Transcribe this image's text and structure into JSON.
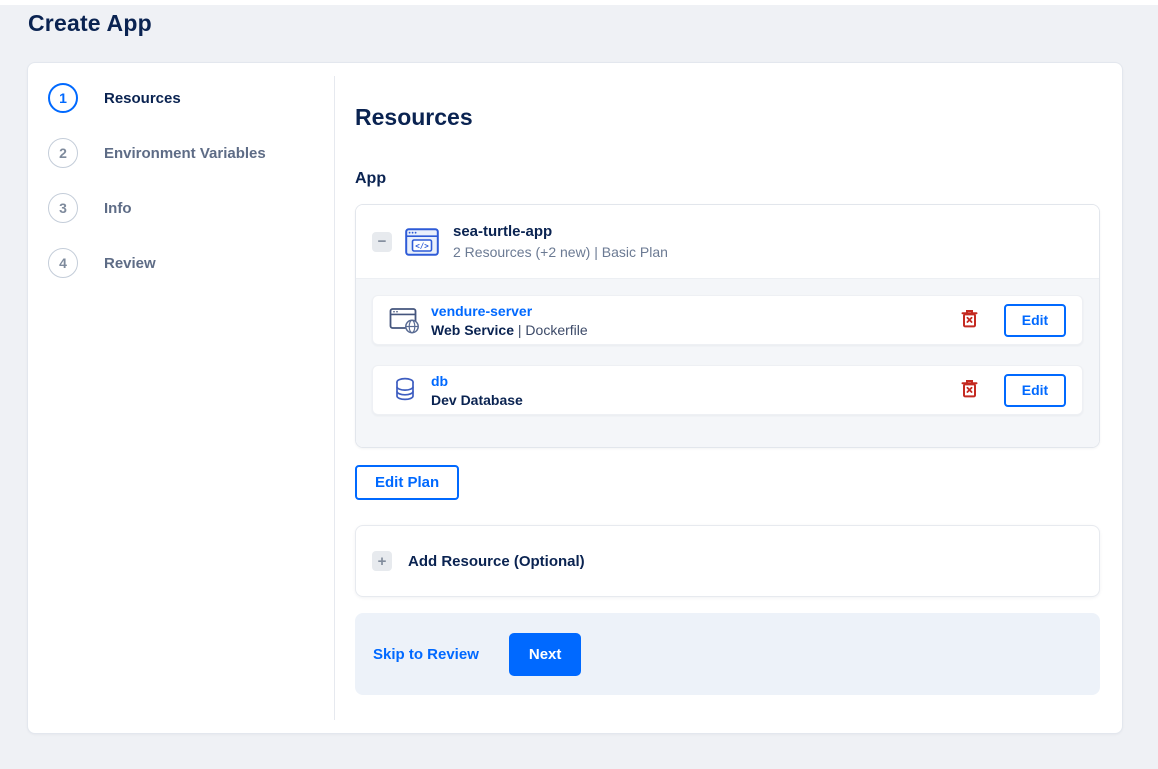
{
  "page": {
    "title": "Create App"
  },
  "steps": [
    {
      "number": "1",
      "label": "Resources",
      "active": true
    },
    {
      "number": "2",
      "label": "Environment Variables",
      "active": false
    },
    {
      "number": "3",
      "label": "Info",
      "active": false
    },
    {
      "number": "4",
      "label": "Review",
      "active": false
    }
  ],
  "main": {
    "title": "Resources",
    "section_label": "App",
    "app_group": {
      "name": "sea-turtle-app",
      "summary": "2 Resources (+2 new) | Basic Plan",
      "collapse_symbol": "−",
      "resources": [
        {
          "name": "vendure-server",
          "type": "Web Service",
          "detail": "| Dockerfile",
          "icon": "web-service-icon",
          "edit_label": "Edit"
        },
        {
          "name": "db",
          "type": "Dev Database",
          "detail": "",
          "icon": "database-icon",
          "edit_label": "Edit"
        }
      ]
    },
    "edit_plan_label": "Edit Plan",
    "add_resource": {
      "symbol": "+",
      "label": "Add Resource (Optional)"
    },
    "footer": {
      "skip_label": "Skip to Review",
      "next_label": "Next"
    }
  },
  "colors": {
    "accent_blue": "#0069ff",
    "navy_text": "#0a2351",
    "secondary_text": "#6b7a93",
    "danger_red": "#c42a21",
    "page_bg": "#eff1f5",
    "group_body_bg": "#f4f6f9",
    "footer_bg": "#edf2f9"
  }
}
